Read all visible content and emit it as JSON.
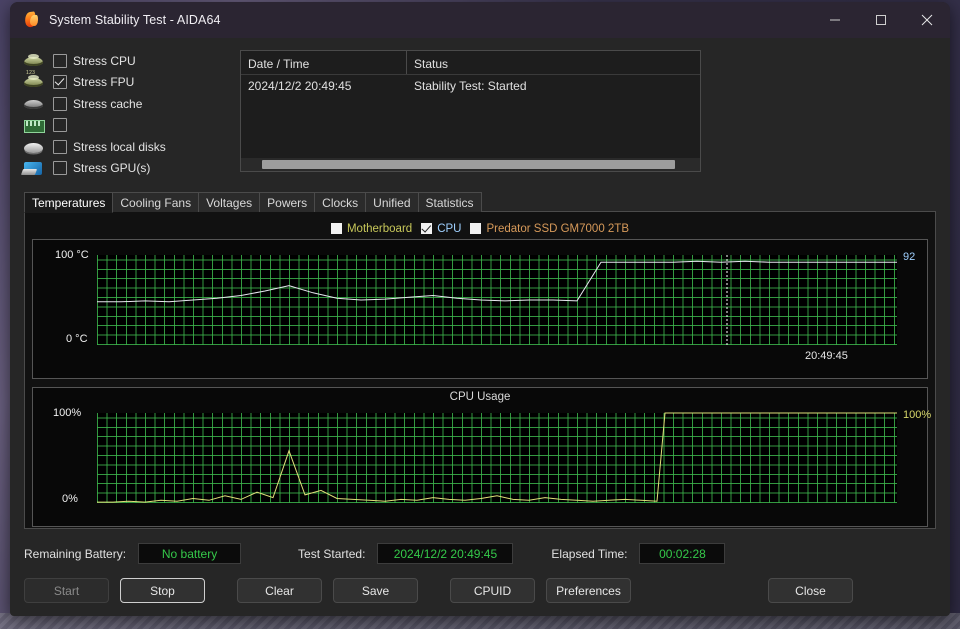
{
  "window": {
    "title": "System Stability Test - AIDA64",
    "app_icon": "flame-icon",
    "minimize_label": "Minimize",
    "maximize_label": "Maximize",
    "close_label": "Close"
  },
  "stress_options": [
    {
      "icon": "cpu-icon",
      "label": "Stress CPU",
      "checked": false
    },
    {
      "icon": "fpu-icon",
      "label": "Stress FPU",
      "checked": true
    },
    {
      "icon": "cache-icon",
      "label": "Stress cache",
      "checked": false
    },
    {
      "icon": "memory-icon",
      "label": "",
      "checked": false
    },
    {
      "icon": "disk-icon",
      "label": "Stress local disks",
      "checked": false
    },
    {
      "icon": "gpu-icon",
      "label": "Stress GPU(s)",
      "checked": false
    }
  ],
  "log": {
    "columns": [
      "Date / Time",
      "Status"
    ],
    "rows": [
      {
        "datetime": "2024/12/2 20:49:45",
        "status": "Stability Test: Started"
      }
    ]
  },
  "tabs": [
    {
      "label": "Temperatures",
      "active": true
    },
    {
      "label": "Cooling Fans",
      "active": false
    },
    {
      "label": "Voltages",
      "active": false
    },
    {
      "label": "Powers",
      "active": false
    },
    {
      "label": "Clocks",
      "active": false
    },
    {
      "label": "Unified",
      "active": false
    },
    {
      "label": "Statistics",
      "active": false
    }
  ],
  "legend": [
    {
      "label": "Motherboard",
      "checked": false,
      "color": "#c8c85a"
    },
    {
      "label": "CPU",
      "checked": true,
      "color": "#9fd0ff"
    },
    {
      "label": "Predator SSD GM7000 2TB",
      "checked": false,
      "color": "#d79a5a"
    }
  ],
  "status": {
    "battery_label": "Remaining Battery:",
    "battery_value": "No battery",
    "started_label": "Test Started:",
    "started_value": "2024/12/2 20:49:45",
    "elapsed_label": "Elapsed Time:",
    "elapsed_value": "00:02:28"
  },
  "buttons": {
    "start": "Start",
    "stop": "Stop",
    "clear": "Clear",
    "save": "Save",
    "cpuid": "CPUID",
    "preferences": "Preferences",
    "close": "Close"
  },
  "chart_data": [
    {
      "type": "line",
      "name": "temperatures",
      "title": "",
      "ylabel": "",
      "ytick_labels": [
        "100 °C",
        "0 °C"
      ],
      "ylim": [
        0,
        100
      ],
      "grid": true,
      "x_marker_label": "20:49:45",
      "current_value_label": "92",
      "current_value_color": "#9fd0ff",
      "series": [
        {
          "name": "CPU",
          "color": "#e8e8f0",
          "x": [
            0,
            3,
            6,
            9,
            12,
            15,
            18,
            21,
            24,
            27,
            30,
            33,
            36,
            39,
            42,
            45,
            48,
            51,
            54,
            57,
            60,
            63,
            66,
            69,
            72,
            75,
            78,
            81,
            84,
            87,
            90,
            93,
            96,
            100
          ],
          "y": [
            48,
            48,
            49,
            48,
            50,
            52,
            55,
            60,
            66,
            58,
            52,
            50,
            51,
            53,
            55,
            52,
            50,
            49,
            50,
            50,
            49,
            92,
            92,
            92,
            92,
            93,
            92,
            93,
            92,
            92,
            92,
            92,
            92,
            92
          ]
        }
      ]
    },
    {
      "type": "line",
      "name": "cpu-usage",
      "title": "CPU Usage",
      "ytick_labels": [
        "100%",
        "0%"
      ],
      "right_value_label": "100%",
      "right_value_color": "#d8d86a",
      "ylim": [
        0,
        100
      ],
      "grid": true,
      "series": [
        {
          "name": "CPU Usage",
          "color": "#e0e07a",
          "x": [
            0,
            2,
            4,
            6,
            8,
            10,
            12,
            14,
            16,
            18,
            20,
            22,
            24,
            26,
            28,
            30,
            32,
            34,
            36,
            38,
            40,
            42,
            44,
            46,
            48,
            50,
            52,
            54,
            56,
            58,
            60,
            62,
            64,
            66,
            68,
            70,
            71,
            72,
            74,
            78,
            82,
            86,
            90,
            94,
            98,
            100
          ],
          "y": [
            1,
            1,
            2,
            1,
            3,
            2,
            5,
            3,
            8,
            4,
            12,
            6,
            58,
            9,
            14,
            5,
            4,
            3,
            2,
            4,
            3,
            6,
            4,
            3,
            5,
            8,
            4,
            3,
            6,
            4,
            3,
            2,
            3,
            4,
            3,
            2,
            100,
            100,
            100,
            100,
            100,
            100,
            100,
            100,
            100,
            100
          ]
        }
      ]
    }
  ]
}
